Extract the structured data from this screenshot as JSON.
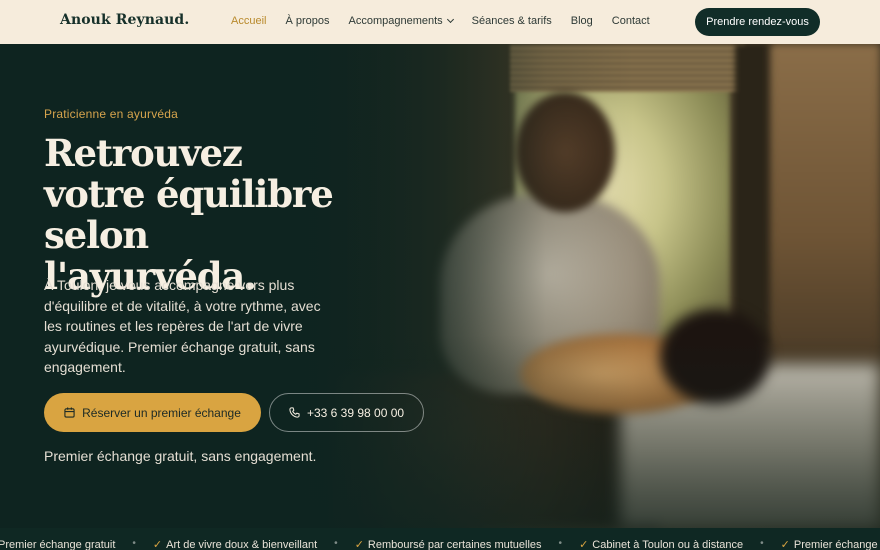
{
  "brand": {
    "name": "Anouk Reynaud."
  },
  "nav": {
    "items": [
      "Accueil",
      "À propos",
      "Accompagnements",
      "Séances & tarifs",
      "Blog",
      "Contact"
    ],
    "active": "Accueil",
    "cta": "Prendre rendez-vous"
  },
  "hero": {
    "eyebrow": "Praticienne en ayurvéda",
    "title": "Retrouvez votre équilibre selon l'ayurvéda.",
    "lead": "À Toulon, je vous accompagne vers plus d'équilibre et de vitalité, à votre rythme, avec les routines et les repères de l'art de vivre ayurvédique. Premier échange gratuit, sans engagement.",
    "primary_button": "Réserver un premier échange",
    "phone_button": "+33 6 39 98 00 00",
    "note": "Premier échange gratuit, sans engagement."
  },
  "marquee": {
    "items": [
      "Premier échange gratuit",
      "Art de vivre doux & bienveillant",
      "Remboursé par certaines mutuelles",
      "Cabinet à Toulon ou à distance",
      "Premier échange gratuit"
    ]
  },
  "icons": {
    "calendar": "calendar-icon",
    "phone": "phone-icon",
    "check": "check-icon",
    "chevron": "chevron-down-icon"
  },
  "colors": {
    "accent": "#d9a441",
    "dark": "#112d28",
    "header_bg": "#f6ecdc"
  }
}
